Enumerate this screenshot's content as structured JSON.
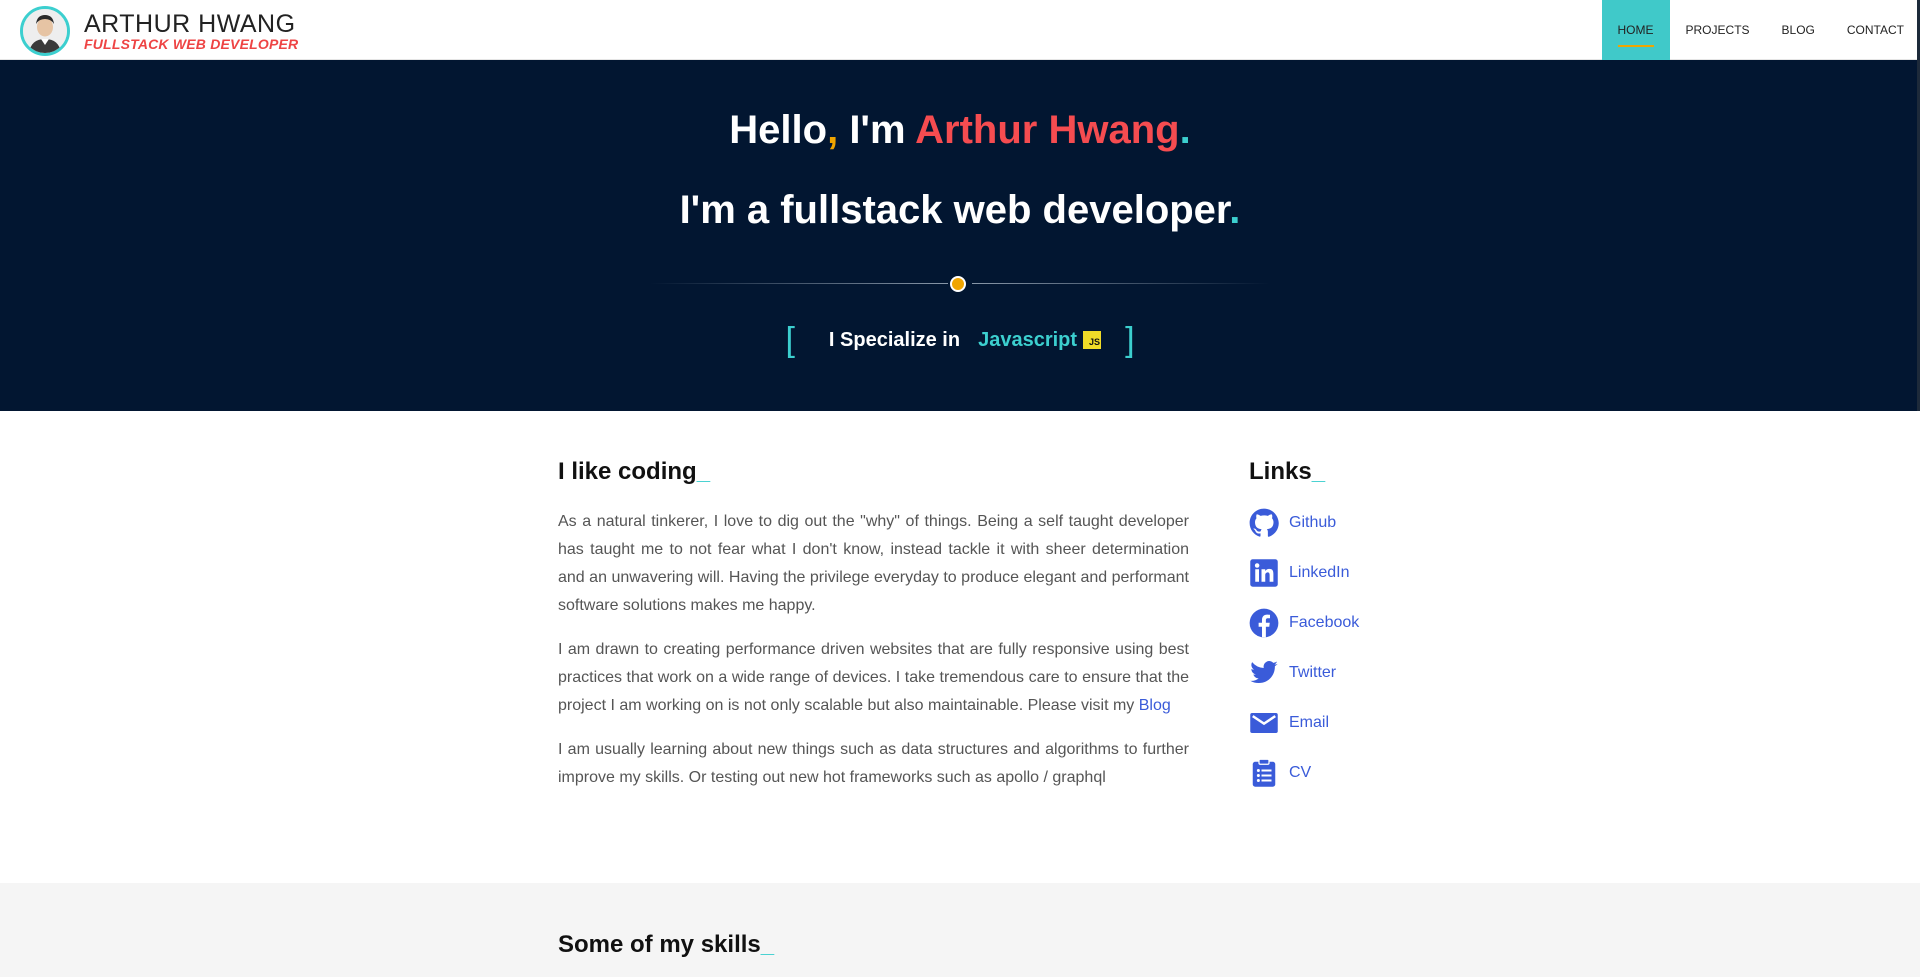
{
  "header": {
    "name": "ARTHUR HWANG",
    "role": "FULLSTACK WEB DEVELOPER",
    "nav": [
      {
        "label": "HOME",
        "active": true
      },
      {
        "label": "PROJECTS",
        "active": false
      },
      {
        "label": "BLOG",
        "active": false
      },
      {
        "label": "CONTACT",
        "active": false
      }
    ]
  },
  "hero": {
    "hello": "Hello",
    "comma": ",",
    "im": " I'm ",
    "name": "Arthur Hwang",
    "period": ".",
    "subtitle": "I'm a fullstack web developer",
    "subtitle_period": ".",
    "specialize_label": "I Specialize in",
    "specialize_value": "Javascript",
    "badge": "JS",
    "bracket_open": "[",
    "bracket_close": "]"
  },
  "about": {
    "heading": "I like coding",
    "cursor": "_",
    "paragraphs": [
      "As a natural tinkerer, I love to dig out the \"why\" of things. Being a self taught developer has taught me to not fear what I don't know, instead tackle it with sheer determination and an unwavering will. Having the privilege everyday to produce elegant and performant software solutions makes me happy.",
      "I am drawn to creating performance driven websites that are fully responsive using best practices that work on a wide range of devices. I take tremendous care to ensure that the project I am working on is not only scalable but also maintainable. Please visit my",
      "I am usually learning about new things such as data structures and algorithms to further improve my skills. Or testing out new hot frameworks such as apollo / graphql"
    ],
    "blog_link": "Blog"
  },
  "links": {
    "heading": "Links",
    "cursor": "_",
    "items": [
      {
        "label": "Github",
        "icon": "github-icon"
      },
      {
        "label": "LinkedIn",
        "icon": "linkedin-icon"
      },
      {
        "label": "Facebook",
        "icon": "facebook-icon"
      },
      {
        "label": "Twitter",
        "icon": "twitter-icon"
      },
      {
        "label": "Email",
        "icon": "email-icon"
      },
      {
        "label": "CV",
        "icon": "clipboard-icon"
      }
    ]
  },
  "skills": {
    "heading": "Some of my skills",
    "cursor": "_"
  },
  "colors": {
    "accent": "#3ccfcf",
    "name_red": "#f54c50",
    "amber": "#f0a500",
    "hero_bg": "#021631",
    "link_blue": "#3a5bd9"
  }
}
